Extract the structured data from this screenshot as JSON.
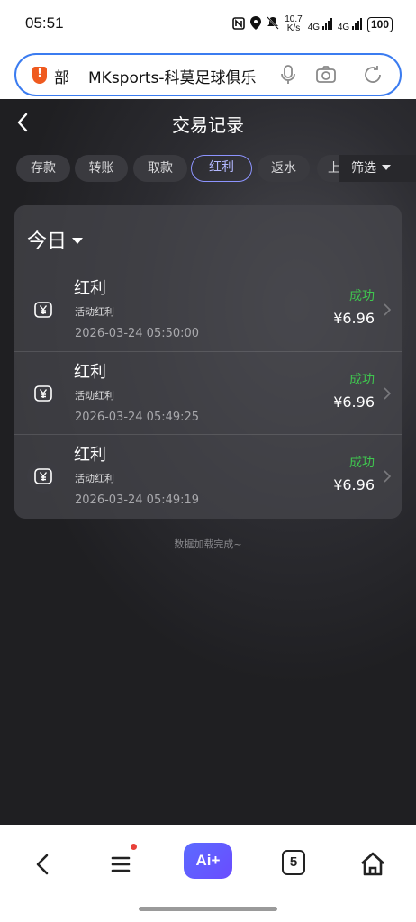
{
  "status_bar": {
    "time": "05:51",
    "speed_top": "10.7",
    "speed_unit": "K/s",
    "network_1": "4G",
    "network_2": "4G",
    "battery": "100"
  },
  "browser": {
    "url_prefix": "部",
    "page_title": "MKsports-科莫足球俱乐",
    "icons": [
      "shield-icon",
      "microphone-icon",
      "camera-icon",
      "refresh-icon"
    ]
  },
  "header": {
    "title": "交易记录"
  },
  "tabs": [
    {
      "label": "存款",
      "active": false
    },
    {
      "label": "转账",
      "active": false
    },
    {
      "label": "取款",
      "active": false
    },
    {
      "label": "红利",
      "active": true
    },
    {
      "label": "返水",
      "active": false
    },
    {
      "label": "上分",
      "active": false
    }
  ],
  "filter_label": "筛选",
  "section": {
    "date_label": "今日"
  },
  "transactions": [
    {
      "title": "红利",
      "subtitle": "活动红利",
      "time": "2026-03-24 05:50:00",
      "status": "成功",
      "amount": "¥6.96"
    },
    {
      "title": "红利",
      "subtitle": "活动红利",
      "time": "2026-03-24 05:49:25",
      "status": "成功",
      "amount": "¥6.96"
    },
    {
      "title": "红利",
      "subtitle": "活动红利",
      "time": "2026-03-24 05:49:19",
      "status": "成功",
      "amount": "¥6.96"
    }
  ],
  "footer_note": "数据加载完成~",
  "bottom_nav": {
    "ai_label": "Ai+",
    "tab_count": "5"
  },
  "colors": {
    "accent": "#8d94ff",
    "success": "#3fc64f",
    "url_border": "#3b7cf0"
  }
}
